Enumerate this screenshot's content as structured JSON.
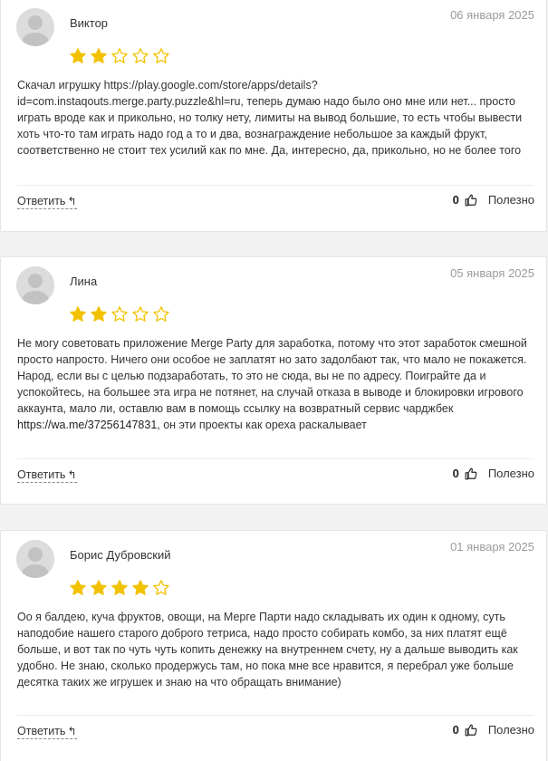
{
  "colors": {
    "star_filled": "#f2c200",
    "star_empty": "#f2c200",
    "background": "#f2f2f2",
    "card": "#ffffff"
  },
  "reviews": [
    {
      "author": "Виктор",
      "date": "06 января 2025",
      "rating": 2,
      "max_rating": 5,
      "text": "Скачал игрушку https://play.google.com/store/apps/details?id=com.instaqouts.merge.party.puzzle&hl=ru, теперь думаю надо было оно мне или нет... просто играть вроде как и прикольно, но толку нету, лимиты на вывод большие, то есть чтобы вывести хоть что-то там играть надо год а то и два, вознаграждение небольшое за каждый фрукт, соответственно не стоит тех усилий как по мне. Да, интересно, да, прикольно, но не более того",
      "reply_label": "Ответить",
      "reply_icon": "reply-arrow-icon",
      "useful_count": "0",
      "useful_label": "Полезно"
    },
    {
      "author": "Лина",
      "date": "05 января 2025",
      "rating": 2,
      "max_rating": 5,
      "text_before_link": "Не могу советовать приложение Merge Party для заработка, потому что этот заработок смешной просто напросто. Ничего они особое не заплатят но зато задолбают так, что мало не покажется. Народ, если вы с целью подзаработать, то это не сюда, вы не по адресу. Поиграйте да и успокойтесь, на большее эта игра не потянет, на случай отказа в выводе и блокировки игрового аккаунта, мало ли, оставлю вам в помощь ссылку на возвратный сервис чарджбек ",
      "link": "https://wa.me/37256147831",
      "text_after_link": ", он эти проекты как ореха раскалывает",
      "reply_label": "Ответить",
      "reply_icon": "reply-arrow-icon",
      "useful_count": "0",
      "useful_label": "Полезно"
    },
    {
      "author": "Борис Дубровский",
      "date": "01 января 2025",
      "rating": 4,
      "max_rating": 5,
      "text": "Оо я балдею, куча фруктов, овощи, на Мерге Парти надо складывать их один к одному, суть наподобие нашего старого доброго тетриса, надо просто собирать комбо, за них платят ещё больше, и вот так по чуть чуть копить денежку на внутреннем счету, ну а дальше выводить как удобно. Не знаю, сколько продержусь там, но пока мне все нравится, я перебрал уже больше десятка таких же игрушек и знаю на что обращать внимание)",
      "reply_label": "Ответить",
      "reply_icon": "reply-arrow-icon",
      "useful_count": "0",
      "useful_label": "Полезно"
    }
  ]
}
